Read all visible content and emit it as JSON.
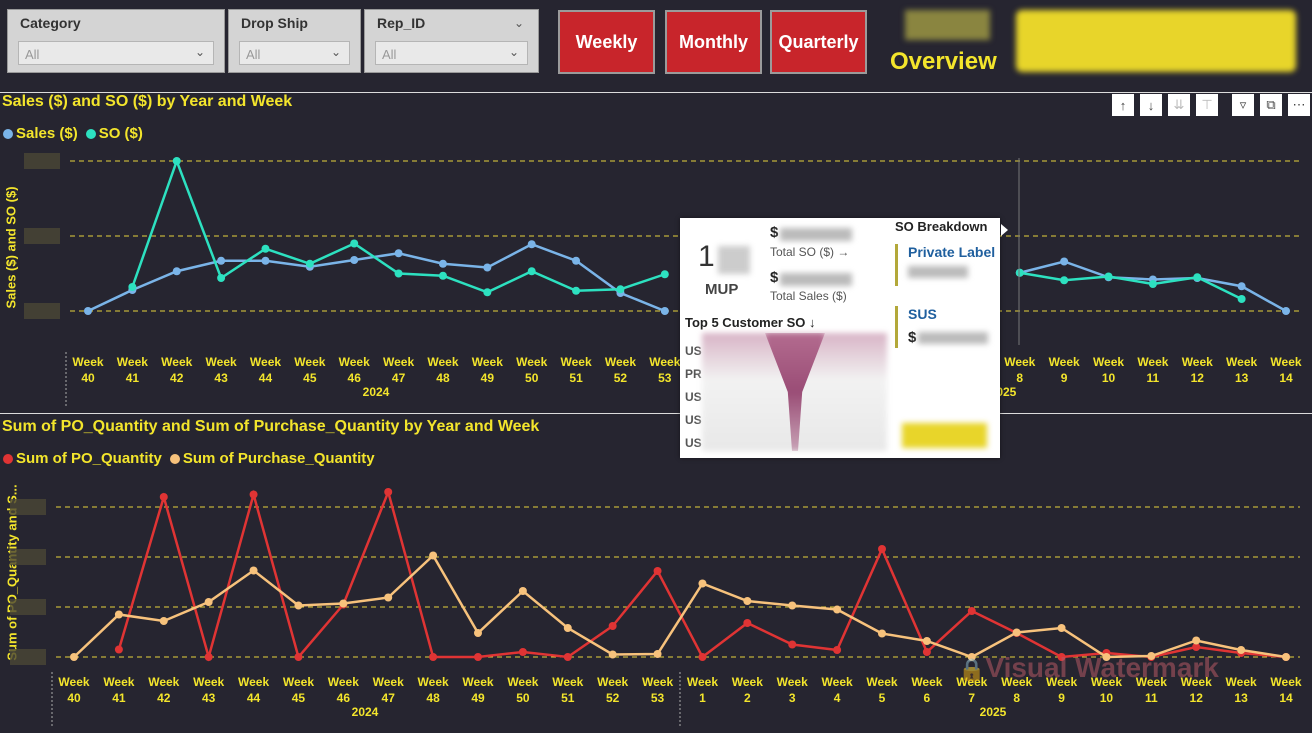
{
  "slicers": [
    {
      "title": "Category",
      "value": "All"
    },
    {
      "title": "Drop Ship",
      "value": "All"
    },
    {
      "title": "Rep_ID",
      "value": "All"
    }
  ],
  "buttons": {
    "weekly": "Weekly",
    "monthly": "Monthly",
    "quarterly": "Quarterly"
  },
  "overview_label": "Overview",
  "colors": {
    "yellow": "#f3e52c",
    "sales": "#7ab4e8",
    "so": "#2de1c0",
    "po": "#e03434",
    "purchase": "#f7c27c",
    "red_btn": "#c8252b",
    "bg": "#262530"
  },
  "top_chart": {
    "title": "Sales ($) and SO ($) by Year and Week",
    "legend": [
      "Sales ($)",
      "SO ($)"
    ],
    "ylabel": "Sales ($) and SO ($)",
    "weeks": [
      "40",
      "41",
      "42",
      "43",
      "44",
      "45",
      "46",
      "47",
      "48",
      "49",
      "50",
      "51",
      "52",
      "53",
      "1",
      "2",
      "3",
      "4",
      "5",
      "6",
      "7",
      "8",
      "9",
      "10",
      "11",
      "12",
      "13",
      "14"
    ],
    "week_prefix": "Week",
    "year_2024": "2024",
    "year_2025": "2025"
  },
  "bottom_chart": {
    "title": "Sum of PO_Quantity and Sum of Purchase_Quantity by Year and Week",
    "legend": [
      "Sum of PO_Quantity",
      "Sum of Purchase_Quantity"
    ],
    "ylabel": "Sum of PO_Quantity and S...",
    "year_2024": "2024",
    "year_2025": "2025"
  },
  "chart_data": [
    {
      "type": "line",
      "title": "Sales ($) and SO ($) by Year and Week",
      "ylabel": "Sales ($) and SO ($)",
      "categories": [
        "2024 W40",
        "2024 W41",
        "2024 W42",
        "2024 W43",
        "2024 W44",
        "2024 W45",
        "2024 W46",
        "2024 W47",
        "2024 W48",
        "2024 W49",
        "2024 W50",
        "2024 W51",
        "2024 W52",
        "2024 W53",
        "2025 W1",
        "2025 W2",
        "2025 W3",
        "2025 W4",
        "2025 W5",
        "2025 W6",
        "2025 W7",
        "2025 W8",
        "2025 W9",
        "2025 W10",
        "2025 W11",
        "2025 W12",
        "2025 W13",
        "2025 W14"
      ],
      "series": [
        {
          "name": "Sales ($)",
          "values": [
            0,
            0.28,
            0.53,
            0.67,
            0.67,
            0.59,
            0.68,
            0.77,
            0.63,
            0.58,
            0.89,
            0.67,
            0.24,
            0,
            null,
            null,
            null,
            null,
            null,
            null,
            null,
            0.51,
            0.66,
            0.45,
            0.42,
            0.44,
            0.33,
            0
          ]
        },
        {
          "name": "SO ($)",
          "values": [
            null,
            0.32,
            2.0,
            0.44,
            0.83,
            0.63,
            0.9,
            0.5,
            0.47,
            0.25,
            0.53,
            0.27,
            0.29,
            0.49,
            null,
            null,
            null,
            null,
            null,
            null,
            null,
            0.51,
            0.41,
            0.46,
            0.36,
            0.45,
            0.16,
            null
          ]
        }
      ]
    },
    {
      "type": "line",
      "title": "Sum of PO_Quantity and Sum of Purchase_Quantity by Year and Week",
      "ylabel": "Sum of PO_Quantity and S...",
      "categories": [
        "2024 W40",
        "2024 W41",
        "2024 W42",
        "2024 W43",
        "2024 W44",
        "2024 W45",
        "2024 W46",
        "2024 W47",
        "2024 W48",
        "2024 W49",
        "2024 W50",
        "2024 W51",
        "2024 W52",
        "2024 W53",
        "2025 W1",
        "2025 W2",
        "2025 W3",
        "2025 W4",
        "2025 W5",
        "2025 W6",
        "2025 W7",
        "2025 W8",
        "2025 W9",
        "2025 W10",
        "2025 W11",
        "2025 W12",
        "2025 W13",
        "2025 W14"
      ],
      "series": [
        {
          "name": "Sum of PO_Quantity",
          "values": [
            null,
            0.15,
            3.2,
            0,
            3.25,
            0,
            1.05,
            3.3,
            0,
            0,
            0.1,
            0,
            0.62,
            1.72,
            0,
            0.68,
            0.25,
            0.14,
            2.16,
            0.1,
            0.92,
            0.48,
            0,
            0.08,
            0,
            0.2,
            0.08,
            0
          ]
        },
        {
          "name": "Sum of Purchase_Quantity",
          "values": [
            0,
            0.85,
            0.72,
            1.1,
            1.73,
            1.03,
            1.07,
            1.19,
            2.03,
            0.48,
            1.32,
            0.58,
            0.05,
            0.06,
            1.47,
            1.12,
            1.03,
            0.95,
            0.47,
            0.32,
            0,
            0.49,
            0.58,
            0,
            0.02,
            0.33,
            0.14,
            0
          ]
        }
      ]
    }
  ],
  "tooltip": {
    "big_number": "1",
    "mup_label": "MUP",
    "currency_symbol": "$",
    "total_so_label": "Total SO ($) →",
    "total_sales_label": "Total Sales ($)",
    "so_breakdown": "SO Breakdown",
    "private_label": "Private Label",
    "sus_label": "SUS",
    "top5_label": "Top 5 Customer SO ↓",
    "customers": [
      "US",
      "PR",
      "US",
      "US",
      "US"
    ]
  },
  "watermark": "Visual Watermark"
}
